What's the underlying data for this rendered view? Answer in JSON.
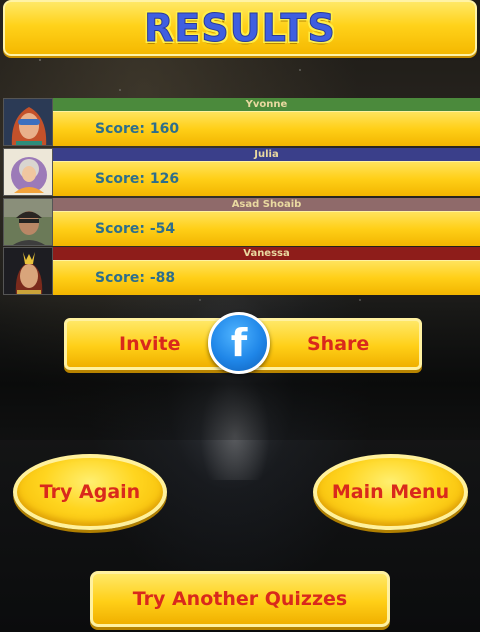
{
  "header": {
    "title": "RESULTS"
  },
  "players": [
    {
      "name": "Yvonne",
      "score_text": "Score: 160",
      "band_color": "#4b8a3c"
    },
    {
      "name": "Julia",
      "score_text": "Score: 126",
      "band_color": "#3a3f8a"
    },
    {
      "name": "Asad Shoaib",
      "score_text": "Score: -54",
      "band_color": "#8f6a6a"
    },
    {
      "name": "Vanessa",
      "score_text": "Score: -88",
      "band_color": "#8e1d1a"
    }
  ],
  "share": {
    "invite_label": "Invite",
    "share_label": "Share",
    "icon": "facebook-icon"
  },
  "actions": {
    "try_again_label": "Try Again",
    "main_menu_label": "Main Menu",
    "another_label": "Try Another Quizzes"
  },
  "colors": {
    "accent_yellow": "#ffcf17",
    "label_red": "#d9291c",
    "score_teal": "#2d6e8c",
    "title_blue": "#3f5fe0"
  }
}
